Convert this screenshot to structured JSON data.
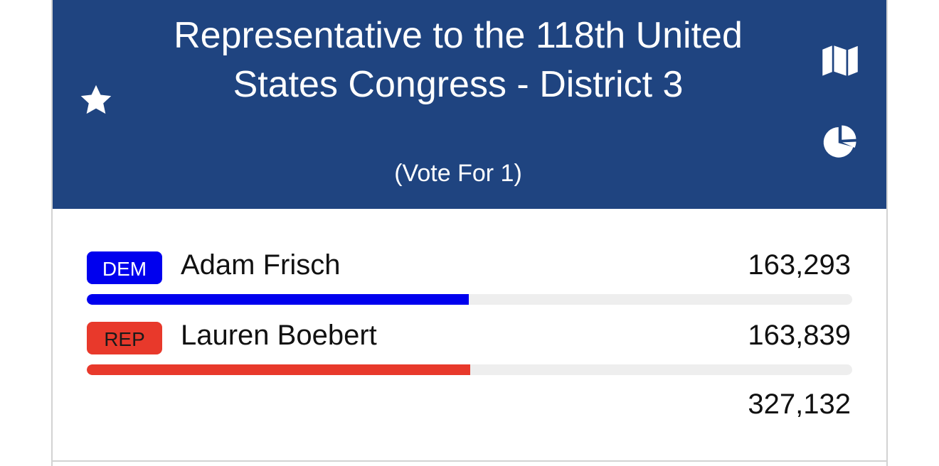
{
  "contest": {
    "title": "Representative to the 118th United States Congress - District 3",
    "vote_for_prefix": "(Vote For ",
    "vote_for_count": "1",
    "vote_for_suffix": ")"
  },
  "icons": {
    "favorite": "star-icon",
    "map": "map-icon",
    "results_chart": "pie-chart-icon"
  },
  "colors": {
    "header_bg": "#1f4480",
    "dem": "#0000ee",
    "rep": "#e8392b",
    "bar_track": "#eeeeee"
  },
  "candidates": [
    {
      "party": "DEM",
      "name": "Adam Frisch",
      "votes": "163,293",
      "vote_share": 0.4992,
      "color": "#0000ee"
    },
    {
      "party": "REP",
      "name": "Lauren Boebert",
      "votes": "163,839",
      "vote_share": 0.5008,
      "color": "#e8392b"
    }
  ],
  "total_votes": "327,132"
}
